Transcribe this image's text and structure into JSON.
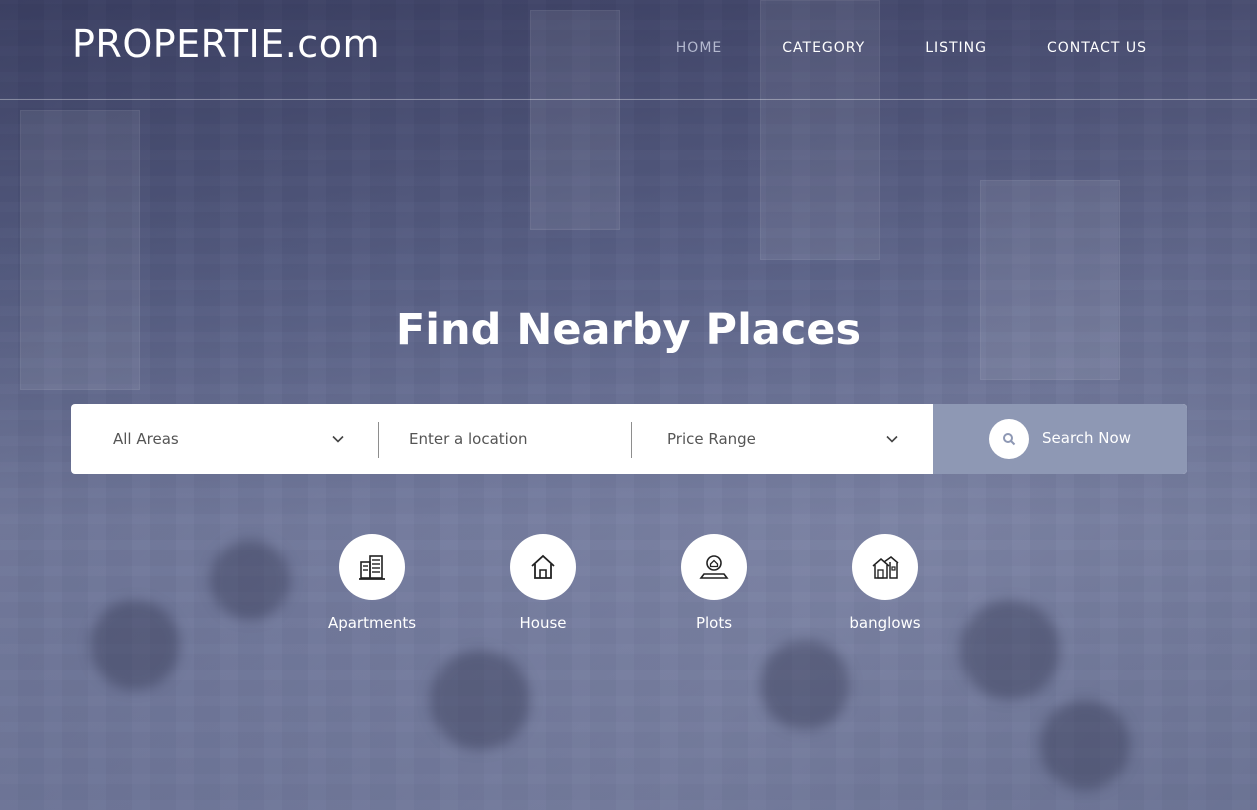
{
  "header": {
    "logo": "PROPERTIE.com",
    "nav": [
      {
        "label": "HOME",
        "active": true
      },
      {
        "label": "CATEGORY",
        "active": false
      },
      {
        "label": "LISTING",
        "active": false
      },
      {
        "label": "CONTACT US",
        "active": false
      }
    ]
  },
  "hero": {
    "title": "Find Nearby Places"
  },
  "search": {
    "area_value": "All Areas",
    "location_placeholder": "Enter a location",
    "price_value": "Price Range",
    "button_label": "Search Now",
    "button_icon": "search-icon"
  },
  "categories": [
    {
      "label": "Apartments",
      "icon": "apartments-icon"
    },
    {
      "label": "House",
      "icon": "house-icon"
    },
    {
      "label": "Plots",
      "icon": "plots-icon"
    },
    {
      "label": "banglows",
      "icon": "bungalow-icon"
    }
  ],
  "colors": {
    "nav_active": "#b4b9cf",
    "search_button": "#8e98b4",
    "text_white": "#ffffff"
  }
}
